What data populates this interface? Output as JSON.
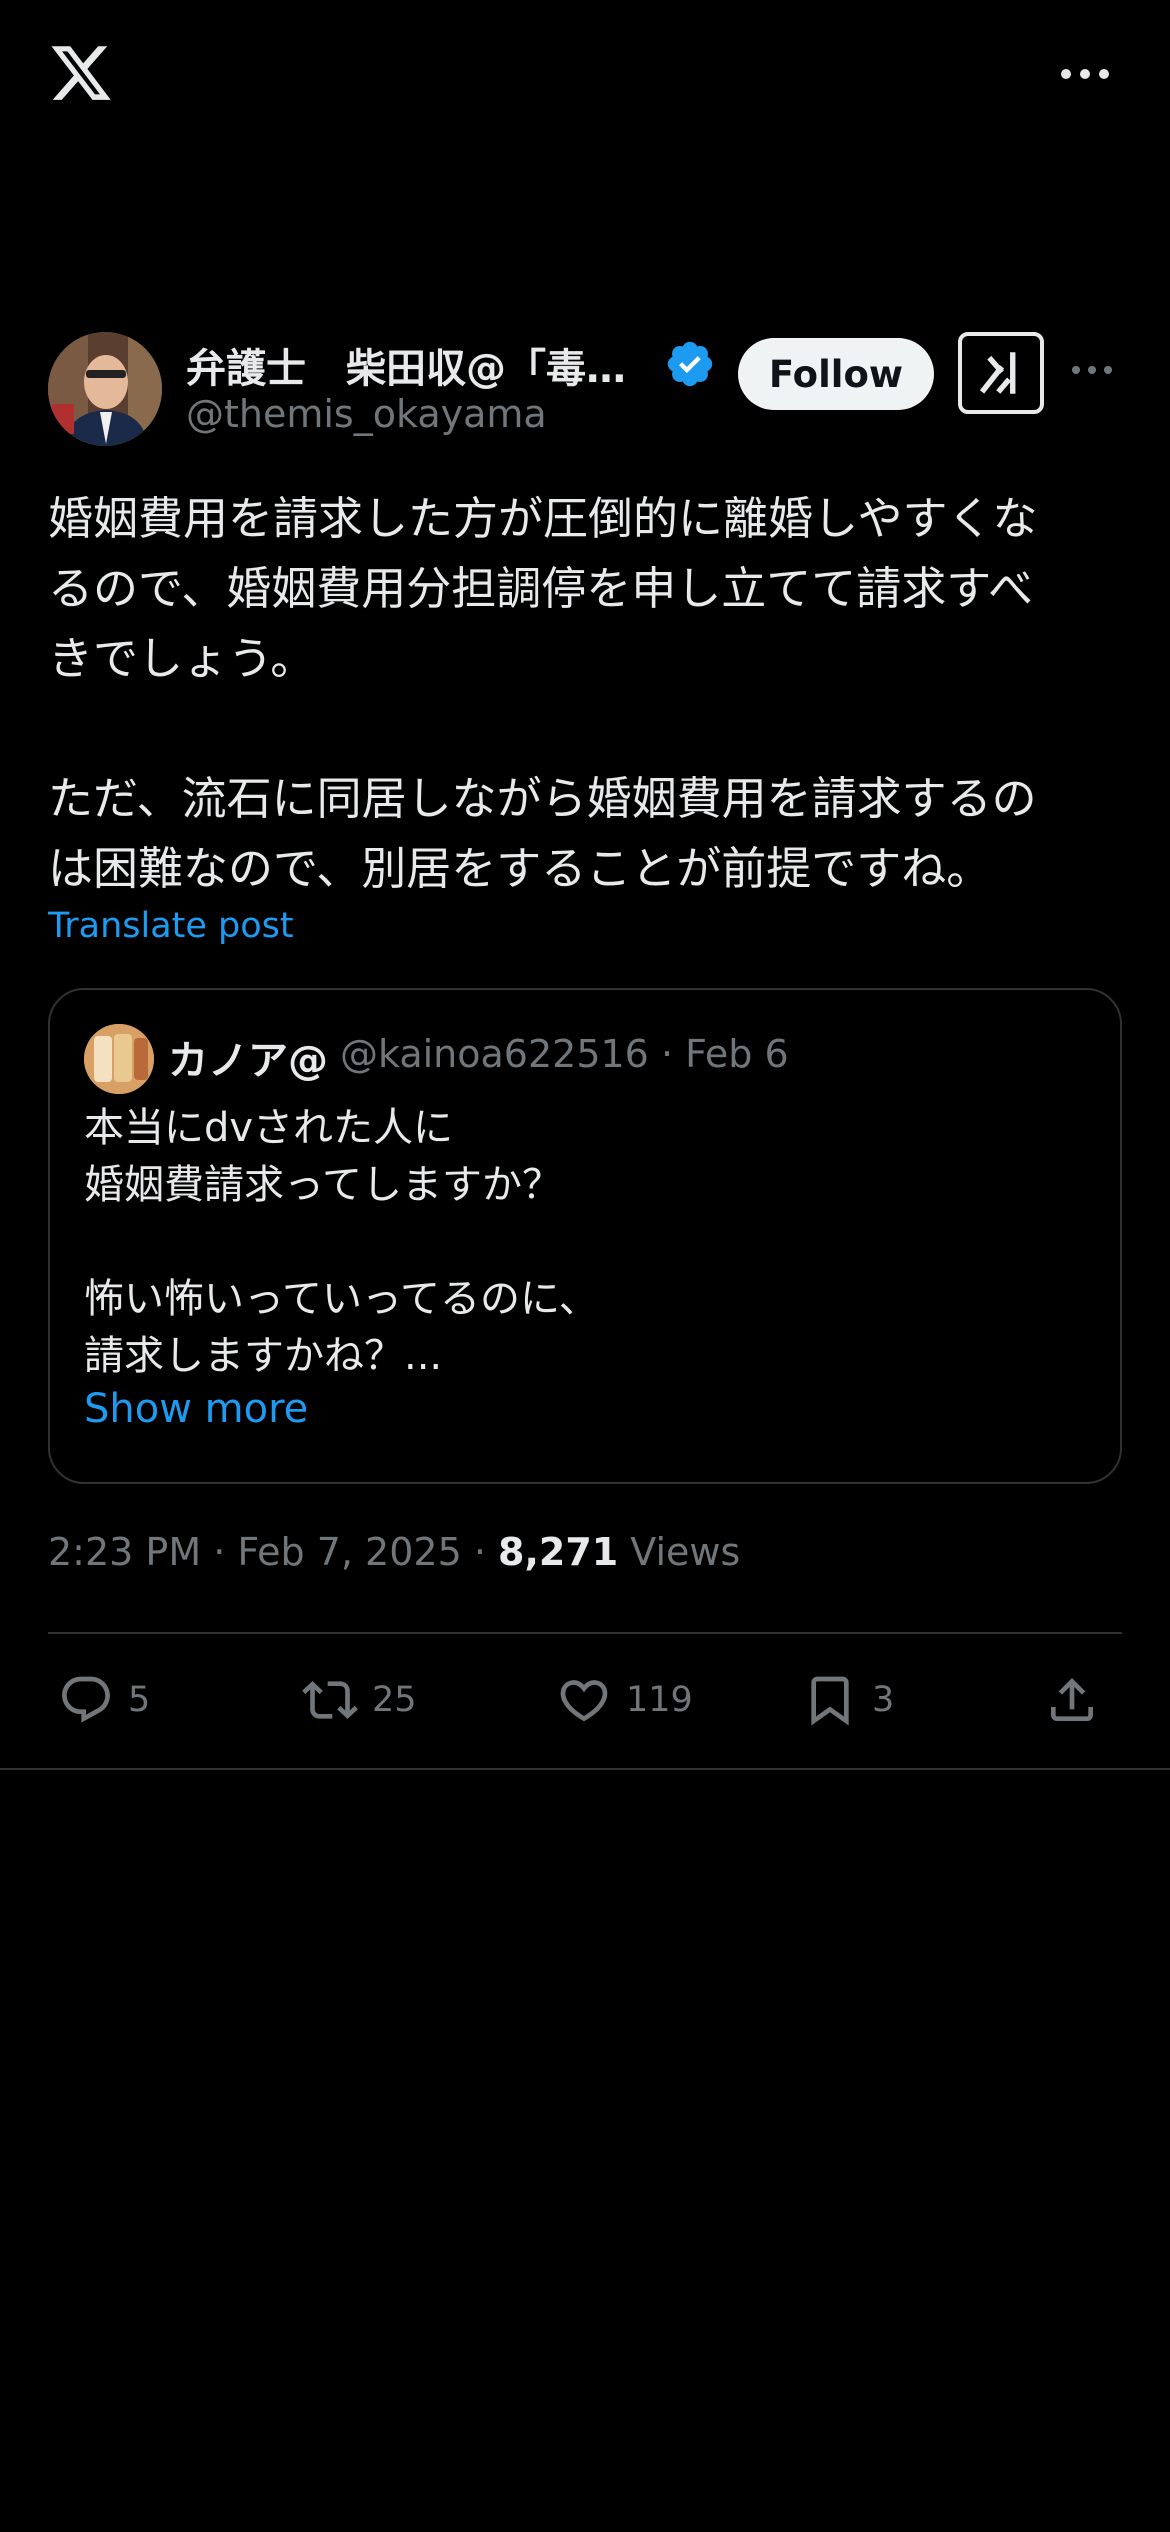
{
  "icons": {
    "x_logo": "x-logo-icon",
    "more": "more-horizontal-icon",
    "verified": "verified-badge-icon",
    "grok": "grok-icon",
    "reply": "reply-icon",
    "repost": "repost-icon",
    "like": "like-icon",
    "bookmark": "bookmark-icon",
    "share": "share-icon"
  },
  "colors": {
    "background": "#000000",
    "accent": "#1d9bf0",
    "text": "#e7e9ea",
    "muted": "#71767b",
    "border": "#2f3336"
  },
  "post": {
    "author_name": "弁護士　柴田収@「毒…",
    "author_handle": "@themis_okayama",
    "follow_label": "Follow",
    "text": "婚姻費用を請求した方が圧倒的に離婚しやすくな\nるので、婚姻費用分担調停を申し立てて請求すべ\nきでしょう。\n\nただ、流石に同居しながら婚姻費用を請求するの\nは困難なので、別居をすることが前提ですね。",
    "translate_label": "Translate post",
    "time": "2:23 PM · Feb 7, 2025 · ",
    "views_count": "8,271",
    "views_label": " Views"
  },
  "quote": {
    "name": "カノア@",
    "handle_date": "@kainoa622516 · Feb 6",
    "text": "本当にdvされた人に\n婚姻費請求ってしますか？\n\n怖い怖いっていってるのに、\n請求しますかね？...",
    "show_more": "Show more"
  },
  "actions": {
    "replies": "5",
    "reposts": "25",
    "likes": "119",
    "bookmarks": "3"
  }
}
